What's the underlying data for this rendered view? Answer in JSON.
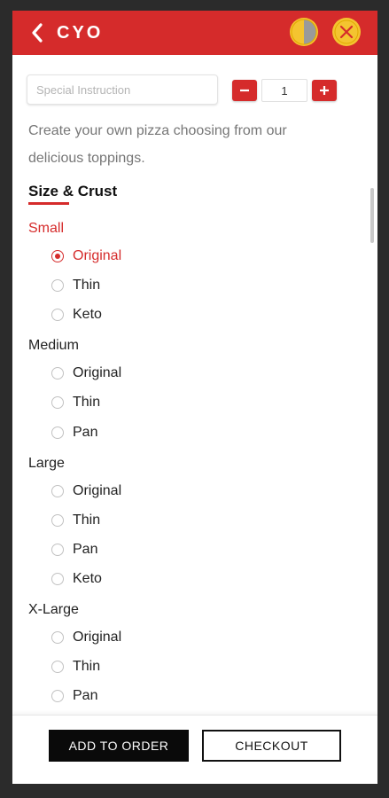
{
  "header": {
    "title": "CYO",
    "back_icon": "chevron-left-icon",
    "half_icon": "half-pizza-icon",
    "close_icon": "close-icon",
    "bar_color": "#d52b2b",
    "icon_color": "#f4c430"
  },
  "instructions": {
    "placeholder": "Special Instruction",
    "value": ""
  },
  "quantity": {
    "value": "1",
    "minus_label": "–",
    "plus_label": "+"
  },
  "description": "Create your own pizza choosing from our delicious toppings.",
  "section": {
    "title": "Size & Crust"
  },
  "sizes": [
    {
      "label": "Small",
      "active": true,
      "options": [
        {
          "label": "Original",
          "selected": true
        },
        {
          "label": "Thin",
          "selected": false
        },
        {
          "label": "Keto",
          "selected": false
        }
      ]
    },
    {
      "label": "Medium",
      "active": false,
      "options": [
        {
          "label": "Original",
          "selected": false
        },
        {
          "label": "Thin",
          "selected": false
        },
        {
          "label": "Pan",
          "selected": false
        }
      ]
    },
    {
      "label": "Large",
      "active": false,
      "options": [
        {
          "label": "Original",
          "selected": false
        },
        {
          "label": "Thin",
          "selected": false
        },
        {
          "label": "Pan",
          "selected": false
        },
        {
          "label": "Keto",
          "selected": false
        }
      ]
    },
    {
      "label": "X-Large",
      "active": false,
      "options": [
        {
          "label": "Original",
          "selected": false
        },
        {
          "label": "Thin",
          "selected": false
        },
        {
          "label": "Pan",
          "selected": false
        }
      ]
    }
  ],
  "footer": {
    "add_label": "ADD TO ORDER",
    "checkout_label": "CHECKOUT"
  }
}
